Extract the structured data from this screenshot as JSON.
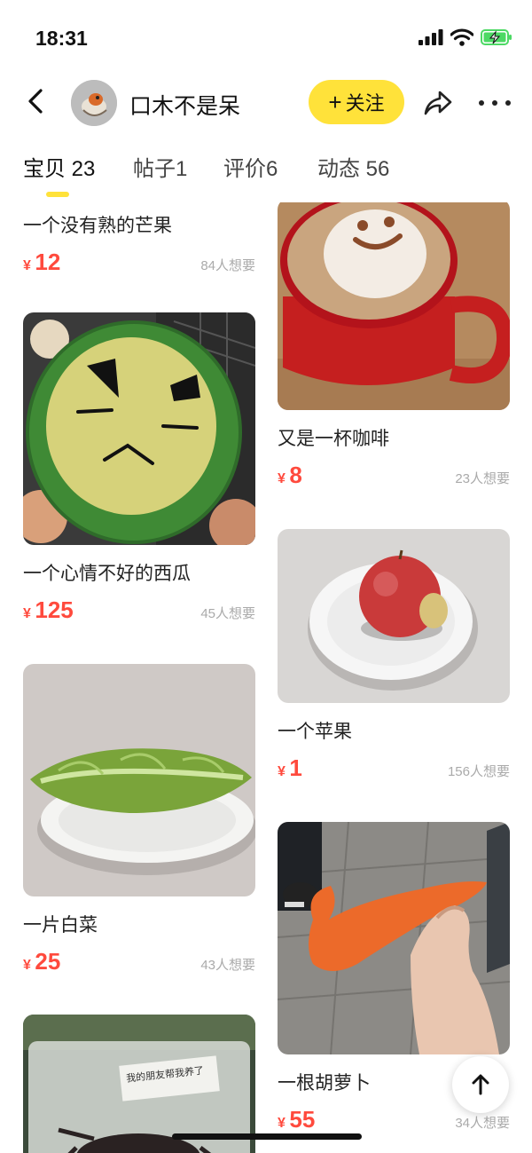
{
  "status_bar": {
    "time": "18:31"
  },
  "header": {
    "shop_name": "口木不是呆",
    "follow_plus": "+",
    "follow_label": "关注"
  },
  "tabs": [
    {
      "label": "宝贝",
      "count": "23"
    },
    {
      "label": "帖子",
      "count": "1"
    },
    {
      "label": "评价",
      "count": "6"
    },
    {
      "label": "动态",
      "count": "56"
    }
  ],
  "currency": "¥",
  "items": [
    {
      "title": "一个没有熟的芒果",
      "price": "12",
      "wants": "84人想要"
    },
    {
      "title": "一个心情不好的西瓜",
      "price": "125",
      "wants": "45人想要"
    },
    {
      "title": "一片白菜",
      "price": "25",
      "wants": "43人想要"
    },
    {
      "title": "又是一杯咖啡",
      "price": "8",
      "wants": "23人想要"
    },
    {
      "title": "一个苹果",
      "price": "1",
      "wants": "156人想要"
    },
    {
      "title": "一根胡萝卜",
      "price": "55",
      "wants": "34人想要"
    }
  ],
  "box_label_handwriting": "我的朋友帮我养了",
  "colors": {
    "accent_yellow": "#ffe23a",
    "price_red": "#ff4a3d",
    "battery_green": "#4cd964"
  }
}
